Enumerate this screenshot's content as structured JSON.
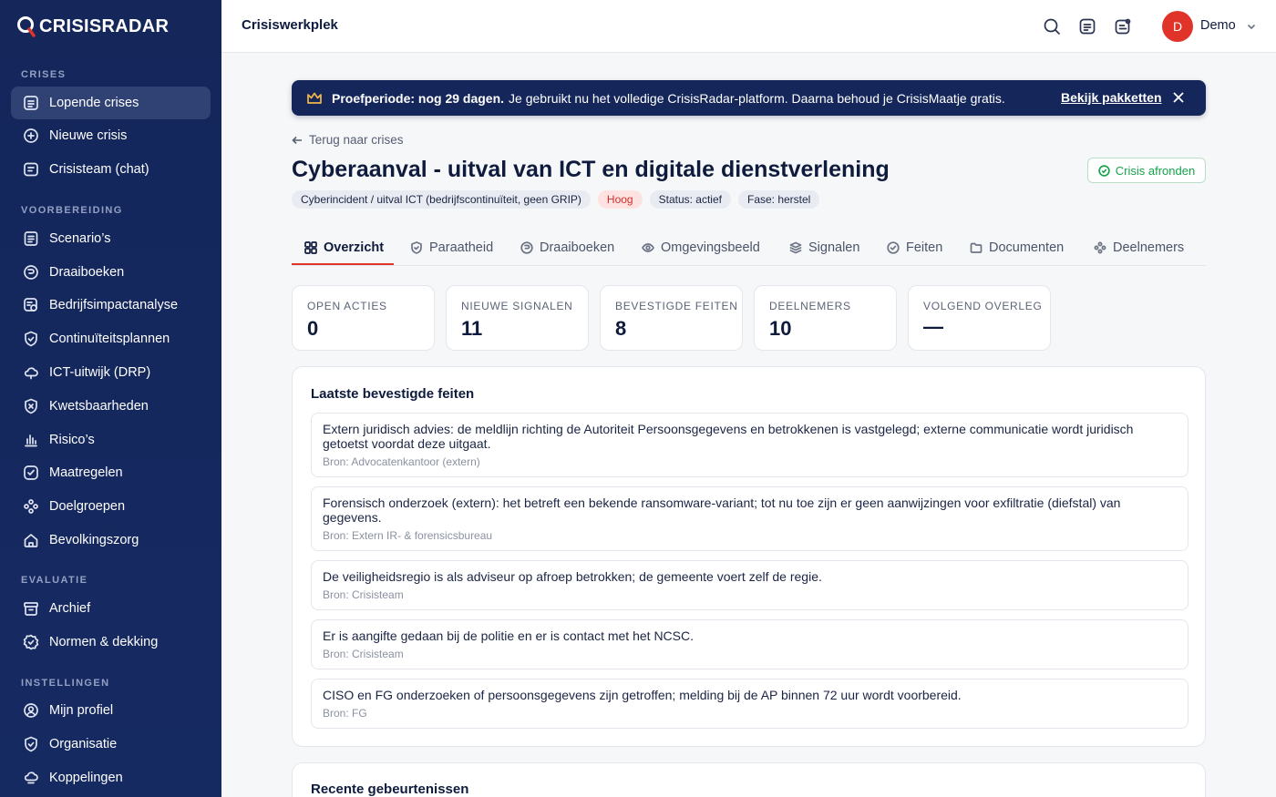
{
  "app": {
    "logo_text": "CRISISRADAR"
  },
  "sidebar": {
    "sections": [
      {
        "title": "CRISES",
        "items": [
          {
            "label": "Lopende crises",
            "icon": "list-icon",
            "active": true
          },
          {
            "label": "Nieuwe crisis",
            "icon": "plus-circle-icon"
          },
          {
            "label": "Crisisteam (chat)",
            "icon": "chat-icon"
          }
        ]
      },
      {
        "title": "VOORBEREIDING",
        "items": [
          {
            "label": "Scenario’s",
            "icon": "document-icon"
          },
          {
            "label": "Draaiboeken",
            "icon": "book-icon"
          },
          {
            "label": "Bedrijfsimpactanalyse",
            "icon": "analysis-icon"
          },
          {
            "label": "Continuïteitsplannen",
            "icon": "shield-icon"
          },
          {
            "label": "ICT-uitwijk (DRP)",
            "icon": "cloud-icon"
          },
          {
            "label": "Kwetsbaarheden",
            "icon": "shield-x-icon"
          },
          {
            "label": "Risico’s",
            "icon": "bar-chart-icon"
          },
          {
            "label": "Maatregelen",
            "icon": "check-square-icon"
          },
          {
            "label": "Doelgroepen",
            "icon": "people-icon"
          },
          {
            "label": "Bevolkingszorg",
            "icon": "home-icon"
          }
        ]
      },
      {
        "title": "EVALUATIE",
        "items": [
          {
            "label": "Archief",
            "icon": "archive-icon"
          },
          {
            "label": "Normen & dekking",
            "icon": "badge-check-icon"
          }
        ]
      },
      {
        "title": "INSTELLINGEN",
        "items": [
          {
            "label": "Mijn profiel",
            "icon": "user-circle-icon"
          },
          {
            "label": "Organisatie",
            "icon": "building-icon"
          },
          {
            "label": "Koppelingen",
            "icon": "cloud-link-icon"
          }
        ]
      }
    ]
  },
  "topbar": {
    "title": "Crisiswerkplek",
    "user_initial": "D",
    "user_name": "Demo"
  },
  "banner": {
    "bold": "Proefperiode: nog 29 dagen.",
    "text": "Je gebruikt nu het volledige CrisisRadar-platform. Daarna behoud je CrisisMaatje gratis.",
    "link": "Bekijk pakketten"
  },
  "back_link": "Terug naar crises",
  "crisis": {
    "title": "Cyberaanval - uitval van ICT en digitale dienstverlening",
    "finish_label": "Crisis afronden",
    "tags": [
      "Cyberincident / uitval ICT (bedrijfscontinuïteit, geen GRIP)",
      "Hoog",
      "Status: actief",
      "Fase: herstel"
    ]
  },
  "tabs": [
    "Overzicht",
    "Paraatheid",
    "Draaiboeken",
    "Omgevingsbeeld",
    "Signalen",
    "Feiten",
    "Documenten",
    "Deelnemers"
  ],
  "stats": [
    {
      "label": "OPEN ACTIES",
      "value": "0"
    },
    {
      "label": "NIEUWE SIGNALEN",
      "value": "11"
    },
    {
      "label": "BEVESTIGDE FEITEN",
      "value": "8"
    },
    {
      "label": "DEELNEMERS",
      "value": "10"
    },
    {
      "label": "VOLGEND OVERLEG",
      "value": "—"
    }
  ],
  "facts_title": "Laatste bevestigde feiten",
  "facts": [
    {
      "text": "Extern juridisch advies: de meldlijn richting de Autoriteit Persoonsgegevens en betrokkenen is vastgelegd; externe communicatie wordt juridisch getoetst voordat deze uitgaat.",
      "source": "Bron: Advocatenkantoor (extern)"
    },
    {
      "text": "Forensisch onderzoek (extern): het betreft een bekende ransomware-variant; tot nu toe zijn er geen aanwijzingen voor exfiltratie (diefstal) van gegevens.",
      "source": "Bron: Extern IR- & forensicsbureau"
    },
    {
      "text": "De veiligheidsregio is als adviseur op afroep betrokken; de gemeente voert zelf de regie.",
      "source": "Bron: Crisisteam"
    },
    {
      "text": "Er is aangifte gedaan bij de politie en er is contact met het NCSC.",
      "source": "Bron: Crisisteam"
    },
    {
      "text": "CISO en FG onderzoeken of persoonsgegevens zijn getroffen; melding bij de AP binnen 72 uur wordt voorbereid.",
      "source": "Bron: FG"
    }
  ],
  "events_title": "Recente gebeurtenissen"
}
